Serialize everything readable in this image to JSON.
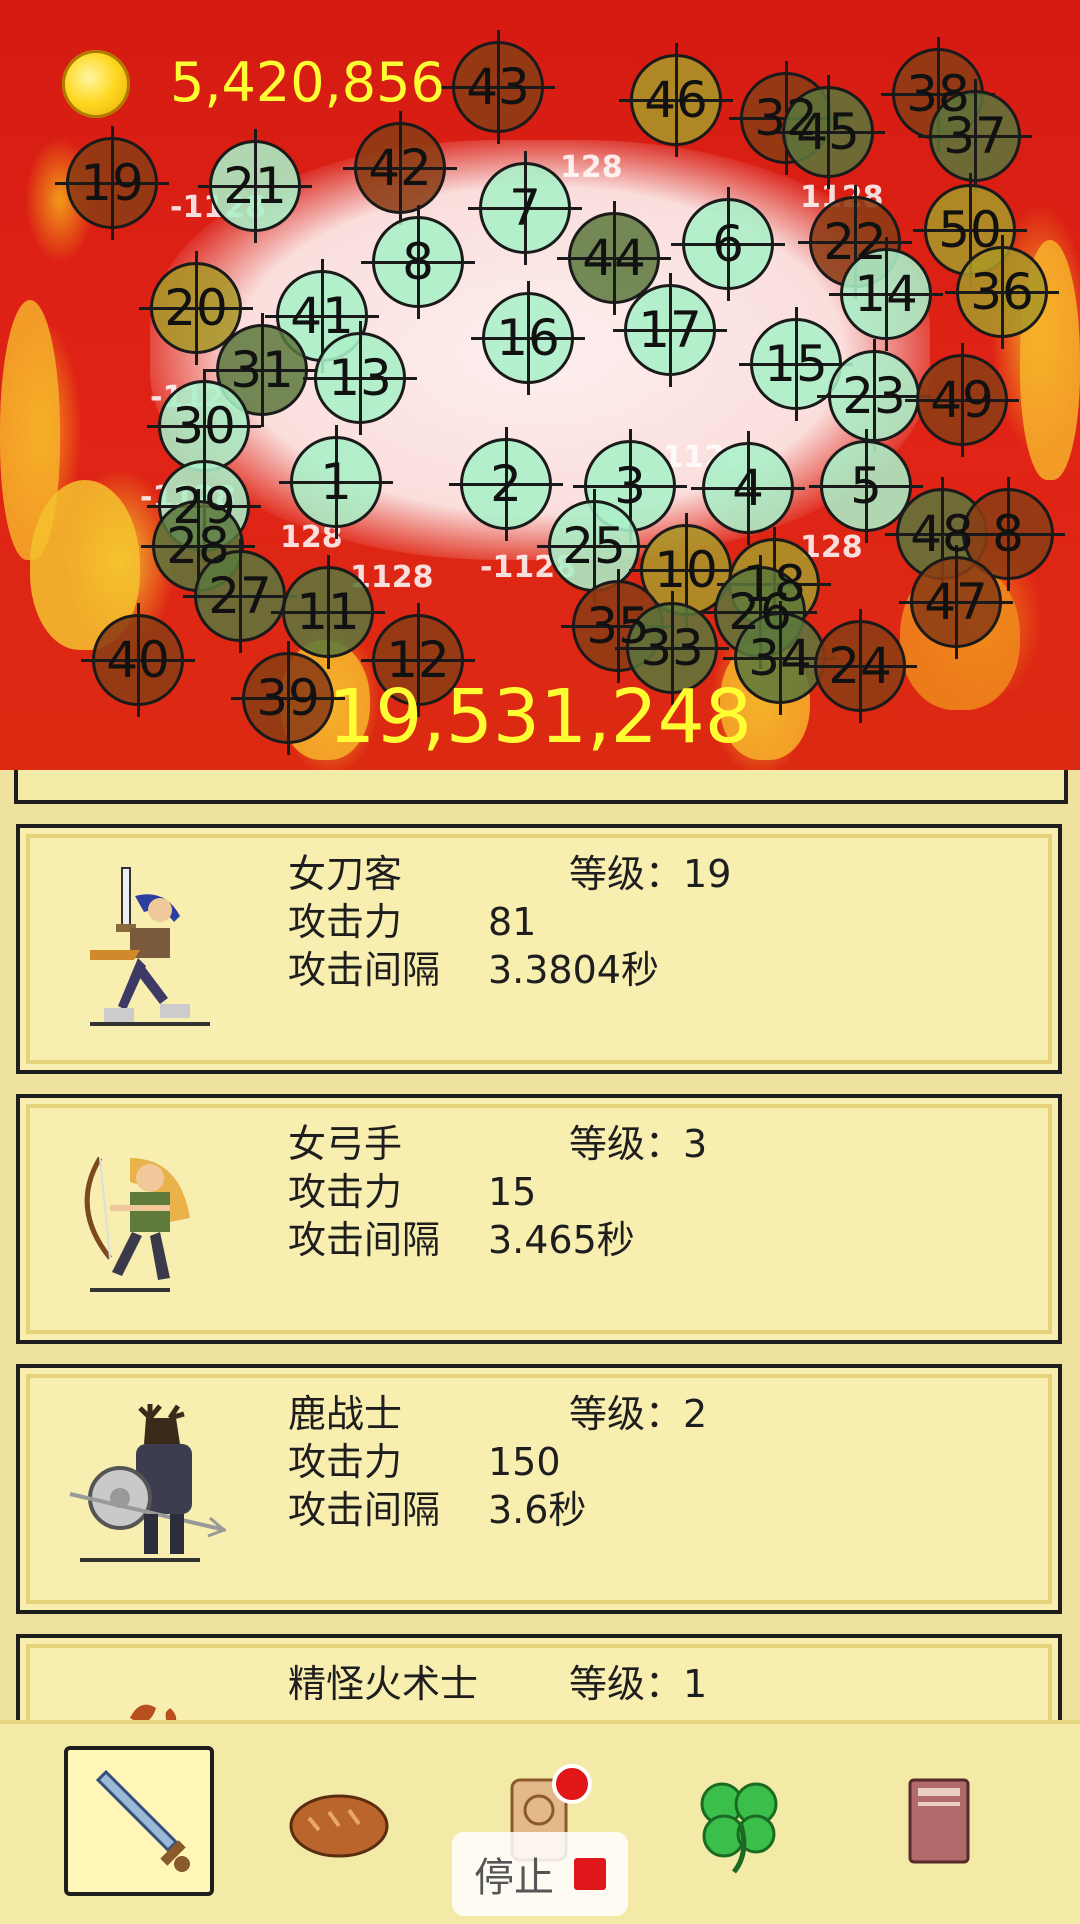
{
  "hud": {
    "gold_amount": "5,420,856",
    "damage_total": "19,531,248"
  },
  "damage_popups": [
    "-1128",
    "128",
    "-1128",
    "1128",
    "-1128",
    "128",
    "1128",
    "-1128",
    "128",
    "-1128"
  ],
  "targets": [
    "19",
    "21",
    "42",
    "43",
    "46",
    "32",
    "45",
    "38",
    "37",
    "7",
    "8",
    "44",
    "6",
    "22",
    "50",
    "20",
    "41",
    "16",
    "17",
    "14",
    "36",
    "31",
    "13",
    "15",
    "23",
    "49",
    "30",
    "1",
    "2",
    "3",
    "4",
    "5",
    "29",
    "28",
    "25",
    "10",
    "18",
    "48",
    "8",
    "27",
    "11",
    "35",
    "33",
    "26",
    "47",
    "40",
    "39",
    "12",
    "34",
    "24"
  ],
  "heroes": [
    {
      "name": "女刀客",
      "level_label": "等级",
      "level": "：19",
      "atk_label": "攻击力",
      "atk": "81",
      "interval_label": "攻击间隔",
      "interval": "3.3804秒"
    },
    {
      "name": "女弓手",
      "level_label": "等级",
      "level": "：3",
      "atk_label": "攻击力",
      "atk": "15",
      "interval_label": "攻击间隔",
      "interval": "3.465秒"
    },
    {
      "name": "鹿战士",
      "level_label": "等级",
      "level": "：2",
      "atk_label": "攻击力",
      "atk": "150",
      "interval_label": "攻击间隔",
      "interval": "3.6秒"
    },
    {
      "name": "精怪火术士",
      "level_label": "等级",
      "level": "：1"
    }
  ],
  "tabs": [
    {
      "icon": "sword-icon",
      "active": true
    },
    {
      "icon": "bread-icon",
      "active": false
    },
    {
      "icon": "scroll-icon",
      "active": false
    },
    {
      "icon": "clover-icon",
      "active": false
    },
    {
      "icon": "book-icon",
      "active": false
    }
  ],
  "stop_button": {
    "label": "停止"
  },
  "colors": {
    "arena_red": "#d51b12",
    "gold_text": "#ffff33",
    "panel_bg": "#f8eeb0",
    "stop_red": "#e0161a"
  }
}
